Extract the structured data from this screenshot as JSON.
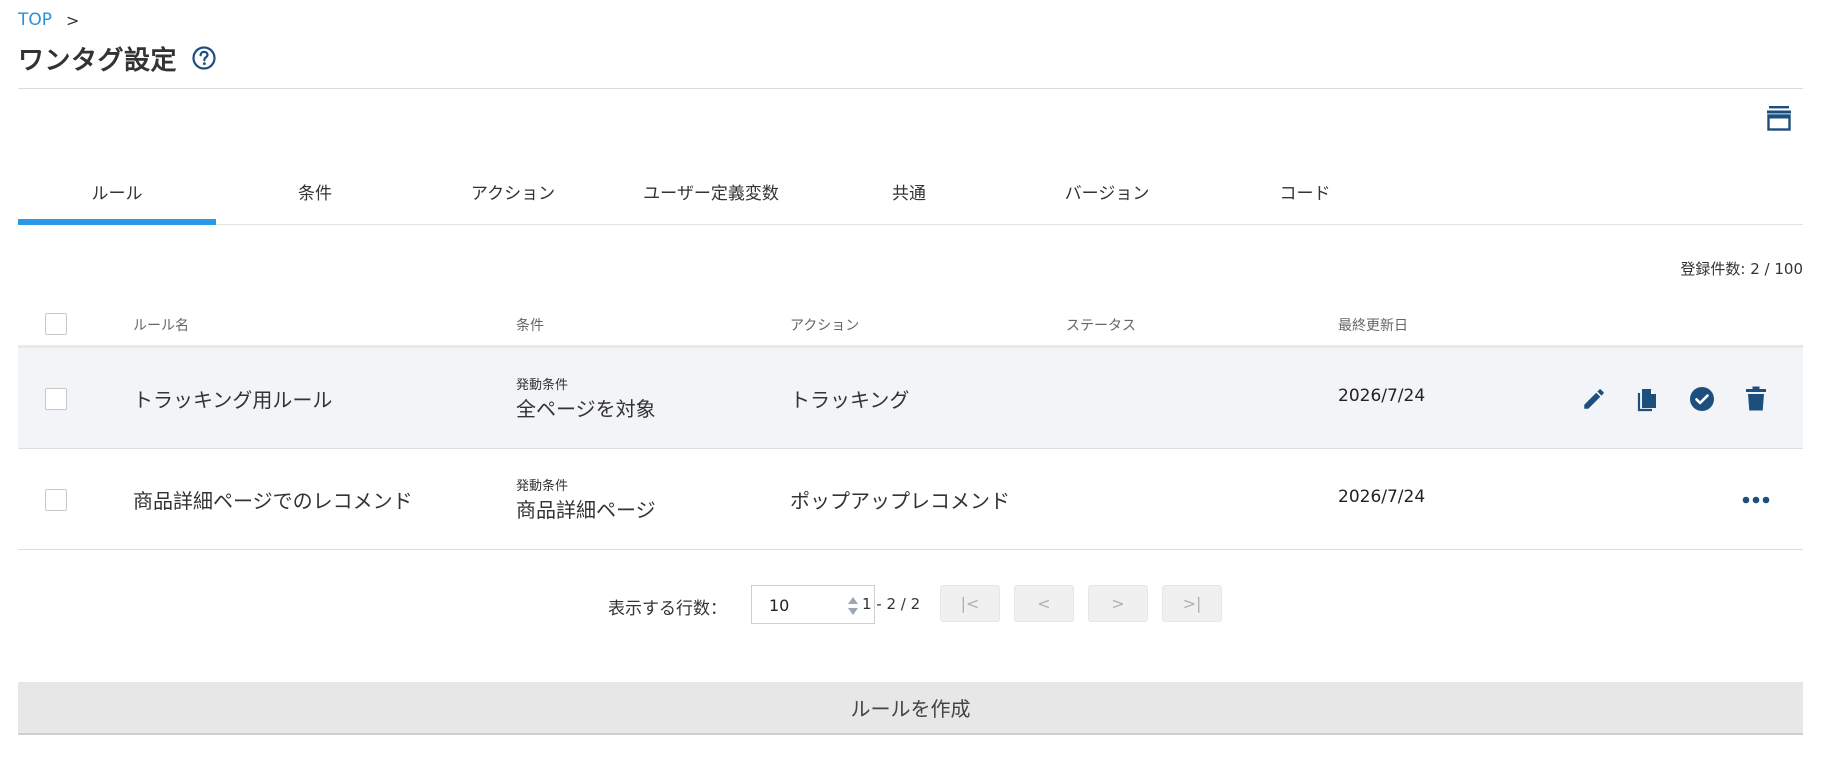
{
  "breadcrumb": {
    "top": "TOP",
    "sep": ">"
  },
  "title": "ワンタグ設定",
  "icons": {
    "help": "help-circle-icon",
    "archive": "archive-icon",
    "edit": "pencil-icon",
    "copy": "copy-icon",
    "approve": "check-circle-icon",
    "delete": "trash-icon",
    "more": "more-horizontal-icon"
  },
  "colors": {
    "accent": "#2b9ae6",
    "icon": "#1c4f7e",
    "link": "#2d8fd5"
  },
  "tabs": [
    {
      "label": "ルール",
      "active": true
    },
    {
      "label": "条件"
    },
    {
      "label": "アクション"
    },
    {
      "label": "ユーザー定義変数"
    },
    {
      "label": "共通"
    },
    {
      "label": "バージョン"
    },
    {
      "label": "コード"
    }
  ],
  "count": "登録件数: 2 / 100",
  "table": {
    "headers": [
      "ルール名",
      "条件",
      "アクション",
      "ステータス",
      "最終更新日"
    ],
    "rows": [
      {
        "name": "トラッキング用ルール",
        "cond_label": "発動条件",
        "cond_value": "全ページを対象",
        "action": "トラッキング",
        "status": "",
        "date": "2026/7/24"
      },
      {
        "name": "商品詳細ページでのレコメンド",
        "cond_label": "発動条件",
        "cond_value": "商品詳細ページ",
        "action": "ポップアップレコメンド",
        "status": "",
        "date": "2026/7/24"
      }
    ]
  },
  "pager": {
    "label": "表示する行数：",
    "rows_value": "10",
    "range": "1 - 2 / 2",
    "first": "|<",
    "prev": "<",
    "next": ">",
    "last": ">|"
  },
  "create_label": "ルールを作成"
}
